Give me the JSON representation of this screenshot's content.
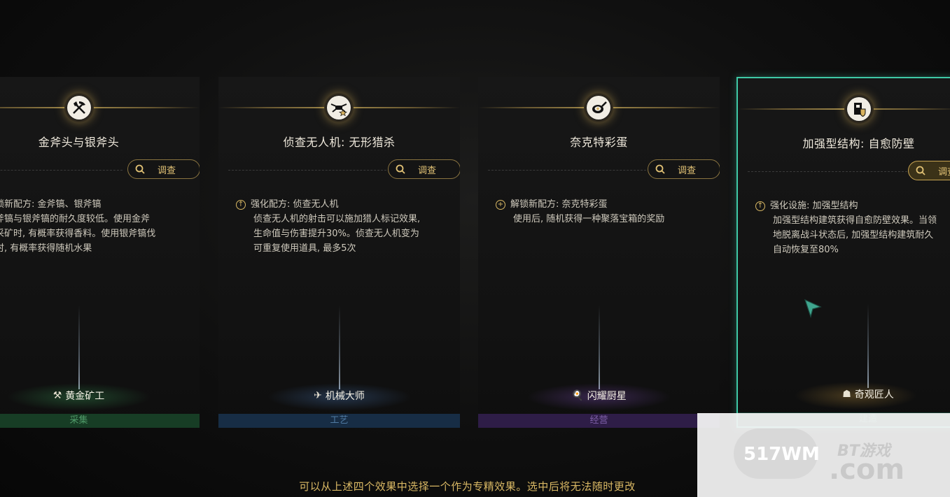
{
  "cards": [
    {
      "title": "金斧头与银斧头",
      "investigate_label": "调查",
      "emblem": "pickaxe-axe-icon",
      "effect": {
        "icon": "unlock-plus-icon",
        "head": "解锁新配方: 金斧镐、银斧镐",
        "lines": [
          "金斧镐与银斧镐的耐久度较低。使用金斧",
          "镐采矿时, 有概率获得香料。使用银斧镐伐",
          "木时, 有概率获得随机水果"
        ]
      },
      "role": "黄金矿工",
      "category": "采集"
    },
    {
      "title": "侦查无人机: 无形猎杀",
      "investigate_label": "调查",
      "emblem": "drone-icon",
      "effect": {
        "icon": "upgrade-icon",
        "head": "强化配方: 侦查无人机",
        "lines": [
          "侦查无人机的射击可以施加猎人标记效果,",
          "生命值与伤害提升30%。侦查无人机变为",
          "可重复使用道具, 最多5次"
        ]
      },
      "role": "机械大师",
      "category": "工艺"
    },
    {
      "title": "奈克特彩蛋",
      "investigate_label": "调查",
      "emblem": "frying-pan-egg-icon",
      "effect": {
        "icon": "unlock-plus-icon",
        "head": "解锁新配方: 奈克特彩蛋",
        "lines": [
          "使用后, 随机获得一种聚落宝箱的奖励"
        ]
      },
      "role": "闪耀厨星",
      "category": "经营"
    },
    {
      "title": "加强型结构: 自愈防壁",
      "investigate_label": "调查",
      "emblem": "fortified-structure-icon",
      "effect": {
        "icon": "upgrade-icon",
        "head": "强化设施: 加强型结构",
        "lines": [
          "加强型结构建筑获得自愈防壁效果。当领",
          "地脱离战斗状态后, 加强型结构建筑耐久",
          "自动恢复至80%"
        ]
      },
      "role": "奇观匠人",
      "category": "建造",
      "selected": true
    }
  ],
  "footer_text": "可以从上述四个效果中选择一个作为专精效果。选中后将无法随时更改",
  "watermark": {
    "num": "517WM",
    "bt": "BT游戏",
    "com": ".com"
  },
  "colors": {
    "gold": "#d9b864",
    "selected_border": "#3fc9a6",
    "cat_gather": "#1e4a2c",
    "cat_craft": "#1c3550",
    "cat_manage": "#3a2458",
    "cat_build": "#1d4a3e"
  }
}
